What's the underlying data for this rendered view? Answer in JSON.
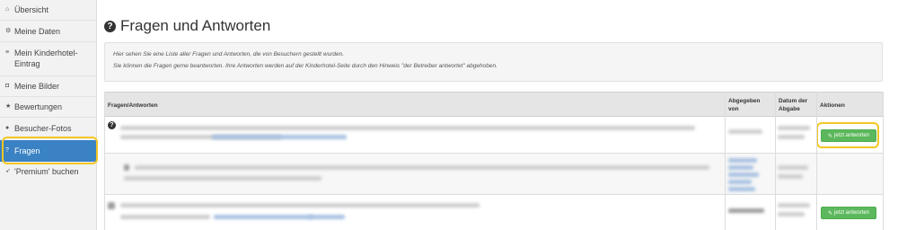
{
  "sidebar": {
    "items": [
      {
        "label": "Übersicht",
        "icon": "home-icon",
        "glyph": "⌂"
      },
      {
        "label": "Meine Daten",
        "icon": "gear-icon",
        "glyph": "⚙"
      },
      {
        "label": "Mein Kinderhotel-Eintrag",
        "icon": "list-icon",
        "glyph": "≡"
      },
      {
        "label": "Meine Bilder",
        "icon": "camera-icon",
        "glyph": "◘"
      },
      {
        "label": "Bewertungen",
        "icon": "star-icon",
        "glyph": "★"
      },
      {
        "label": "Besucher-Fotos",
        "icon": "user-icon",
        "glyph": "●"
      },
      {
        "label": "Fragen",
        "icon": "question-icon",
        "glyph": "?",
        "active": true
      },
      {
        "label": "'Premium' buchen",
        "icon": "rocket-icon",
        "glyph": "➶"
      }
    ],
    "active_color": "#3a82c3"
  },
  "page": {
    "title": "Fragen und Antworten",
    "title_icon_glyph": "?"
  },
  "info": {
    "line1": "Hier sehen Sie eine Liste aller Fragen und Antworten, die von Besuchern gestellt wurden.",
    "line2": "Sie können die Fragen gerne beantworten. Ihre Antworten werden auf der Kinderhotel-Seite durch den Hinweis \"der Betreiber antwortet\" abgehoben."
  },
  "table": {
    "columns": {
      "qa": "Fragen/Antworten",
      "submitted_by_1": "Abgegeben",
      "submitted_by_2": "von",
      "date_1": "Datum der",
      "date_2": "Abgabe",
      "actions": "Aktionen"
    },
    "answer_button": "jetzt antworten",
    "pencil_glyph": "✎",
    "question_glyph": "?"
  },
  "colors": {
    "accent": "#3a82c3",
    "button": "#5cb85c",
    "highlight": "#f3c623"
  }
}
